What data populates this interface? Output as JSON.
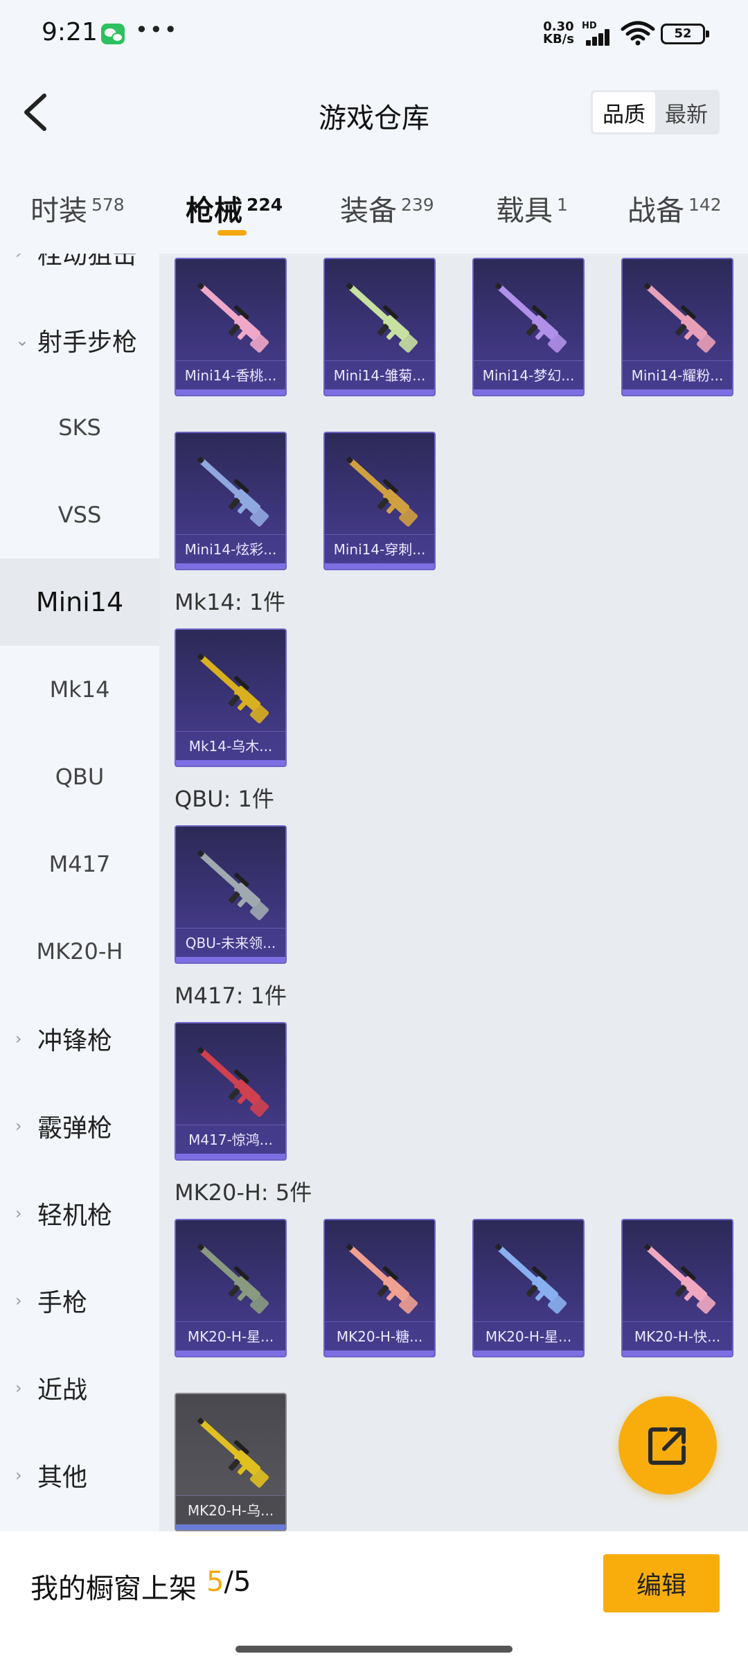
{
  "status_bar": {
    "time": "9:21",
    "dots": "•••",
    "speed_value": "0.30",
    "speed_unit": "KB/s",
    "hd": "HD",
    "battery": "52"
  },
  "header": {
    "title": "游戏仓库",
    "sort_quality": "品质",
    "sort_newest": "最新"
  },
  "tabs": [
    {
      "label": "时装",
      "count": "578"
    },
    {
      "label": "枪械",
      "count": "224"
    },
    {
      "label": "装备",
      "count": "239"
    },
    {
      "label": "载具",
      "count": "1"
    },
    {
      "label": "战备",
      "count": "142"
    }
  ],
  "sidebar": [
    {
      "label": "栓动狙击"
    },
    {
      "label": "射手步枪"
    },
    {
      "label": "SKS"
    },
    {
      "label": "VSS"
    },
    {
      "label": "Mini14"
    },
    {
      "label": "Mk14"
    },
    {
      "label": "QBU"
    },
    {
      "label": "M417"
    },
    {
      "label": "MK20-H"
    },
    {
      "label": "冲锋枪"
    },
    {
      "label": "霰弹枪"
    },
    {
      "label": "轻机枪"
    },
    {
      "label": "手枪"
    },
    {
      "label": "近战"
    },
    {
      "label": "其他"
    }
  ],
  "groups": {
    "mk14": "Mk14: 1件",
    "qbu": "QBU: 1件",
    "m417": "M417: 1件",
    "mk20": "MK20-H: 5件"
  },
  "items": [
    {
      "name": "Mini14-香桃...",
      "color": "#f0a8c8"
    },
    {
      "name": "Mini14-雏菊...",
      "color": "#c8e0a0"
    },
    {
      "name": "Mini14-梦幻...",
      "color": "#b090e8"
    },
    {
      "name": "Mini14-耀粉...",
      "color": "#e8a0b8"
    },
    {
      "name": "Mini14-炫彩...",
      "color": "#90a8e0"
    },
    {
      "name": "Mini14-穿刺...",
      "color": "#d0a040"
    },
    {
      "name": "Mk14-乌木...",
      "color": "#d8b020"
    },
    {
      "name": "QBU-未来领...",
      "color": "#a0a8b0"
    },
    {
      "name": "M417-惊鸿...",
      "color": "#d04050"
    },
    {
      "name": "MK20-H-星...",
      "color": "#8a9a80"
    },
    {
      "name": "MK20-H-糖...",
      "color": "#f0a090"
    },
    {
      "name": "MK20-H-星...",
      "color": "#88b0f0"
    },
    {
      "name": "MK20-H-快...",
      "color": "#f0a8c0"
    },
    {
      "name": "MK20-H-乌...",
      "color": "#e0c020"
    }
  ],
  "bottom": {
    "showcase_label": "我的橱窗上架",
    "showcase_current": "5",
    "showcase_sep": "/",
    "showcase_total": "5",
    "edit_label": "编辑"
  }
}
